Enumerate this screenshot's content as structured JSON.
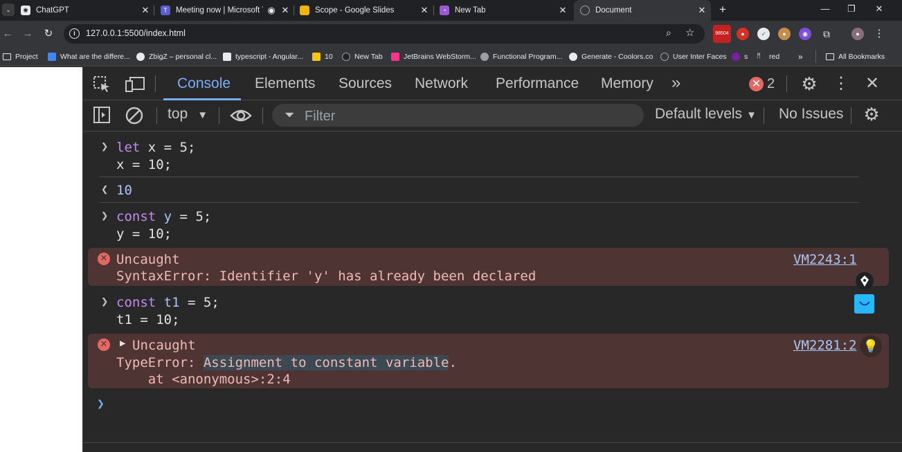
{
  "tabs": [
    {
      "title": "ChatGPT",
      "icon": "chatgpt-icon"
    },
    {
      "title": "Meeting now | Microsoft Te",
      "icon": "teams-icon"
    },
    {
      "title": "Scope - Google Slides",
      "icon": "slides-icon"
    },
    {
      "title": "New Tab",
      "icon": "newtab-icon"
    },
    {
      "title": "Document",
      "icon": "document-icon"
    }
  ],
  "toolbar": {
    "url": "127.0.0.1:5500/index.html",
    "ext_badge": "98504"
  },
  "bookmarks": [
    {
      "label": "Project"
    },
    {
      "label": "What are the differe..."
    },
    {
      "label": "ZbigZ – personal cl..."
    },
    {
      "label": "typescript - Angular..."
    },
    {
      "label": "10"
    },
    {
      "label": "New Tab"
    },
    {
      "label": "JetBrains WebStorm..."
    },
    {
      "label": "Functional Program..."
    },
    {
      "label": "Generate - Coolors.co"
    },
    {
      "label": "User Inter Faces"
    },
    {
      "label": "s"
    },
    {
      "label": "red"
    },
    {
      "label": "All Bookmarks"
    }
  ],
  "devtools": {
    "tabs": [
      "Console",
      "Elements",
      "Sources",
      "Network",
      "Performance",
      "Memory"
    ],
    "error_count": "2",
    "context": "top",
    "filter_placeholder": "Filter",
    "levels": "Default levels",
    "issues": "No Issues"
  },
  "console": {
    "entry1": {
      "l1_kw": "let",
      "l1_rest": " x = ",
      "l1_num": "5",
      "l1_end": ";",
      "l2_a": "x = ",
      "l2_num": "10",
      "l2_end": ";"
    },
    "result1": "10",
    "entry2": {
      "l1_kw": "const",
      "l1_var": "y",
      "l1_rest": " = ",
      "l1_num": "5",
      "l1_end": ";",
      "l2_a": "y = ",
      "l2_num": "10",
      "l2_end": ";"
    },
    "error1": {
      "title": "Uncaught",
      "message": "SyntaxError: Identifier 'y' has already been declared",
      "link": "VM2243:1"
    },
    "entry3": {
      "l1_kw": "const",
      "l1_var": "t1",
      "l1_rest": " = ",
      "l1_num": "5",
      "l1_end": ";",
      "l2_a": "t1 = ",
      "l2_num": "10",
      "l2_end": ";"
    },
    "error2": {
      "title": "Uncaught",
      "msg_prefix": "TypeError: ",
      "msg_highlight": "Assignment to constant variable",
      "msg_end": ".",
      "stack": "    at <anonymous>:2:4",
      "link": "VM2281:2"
    }
  }
}
